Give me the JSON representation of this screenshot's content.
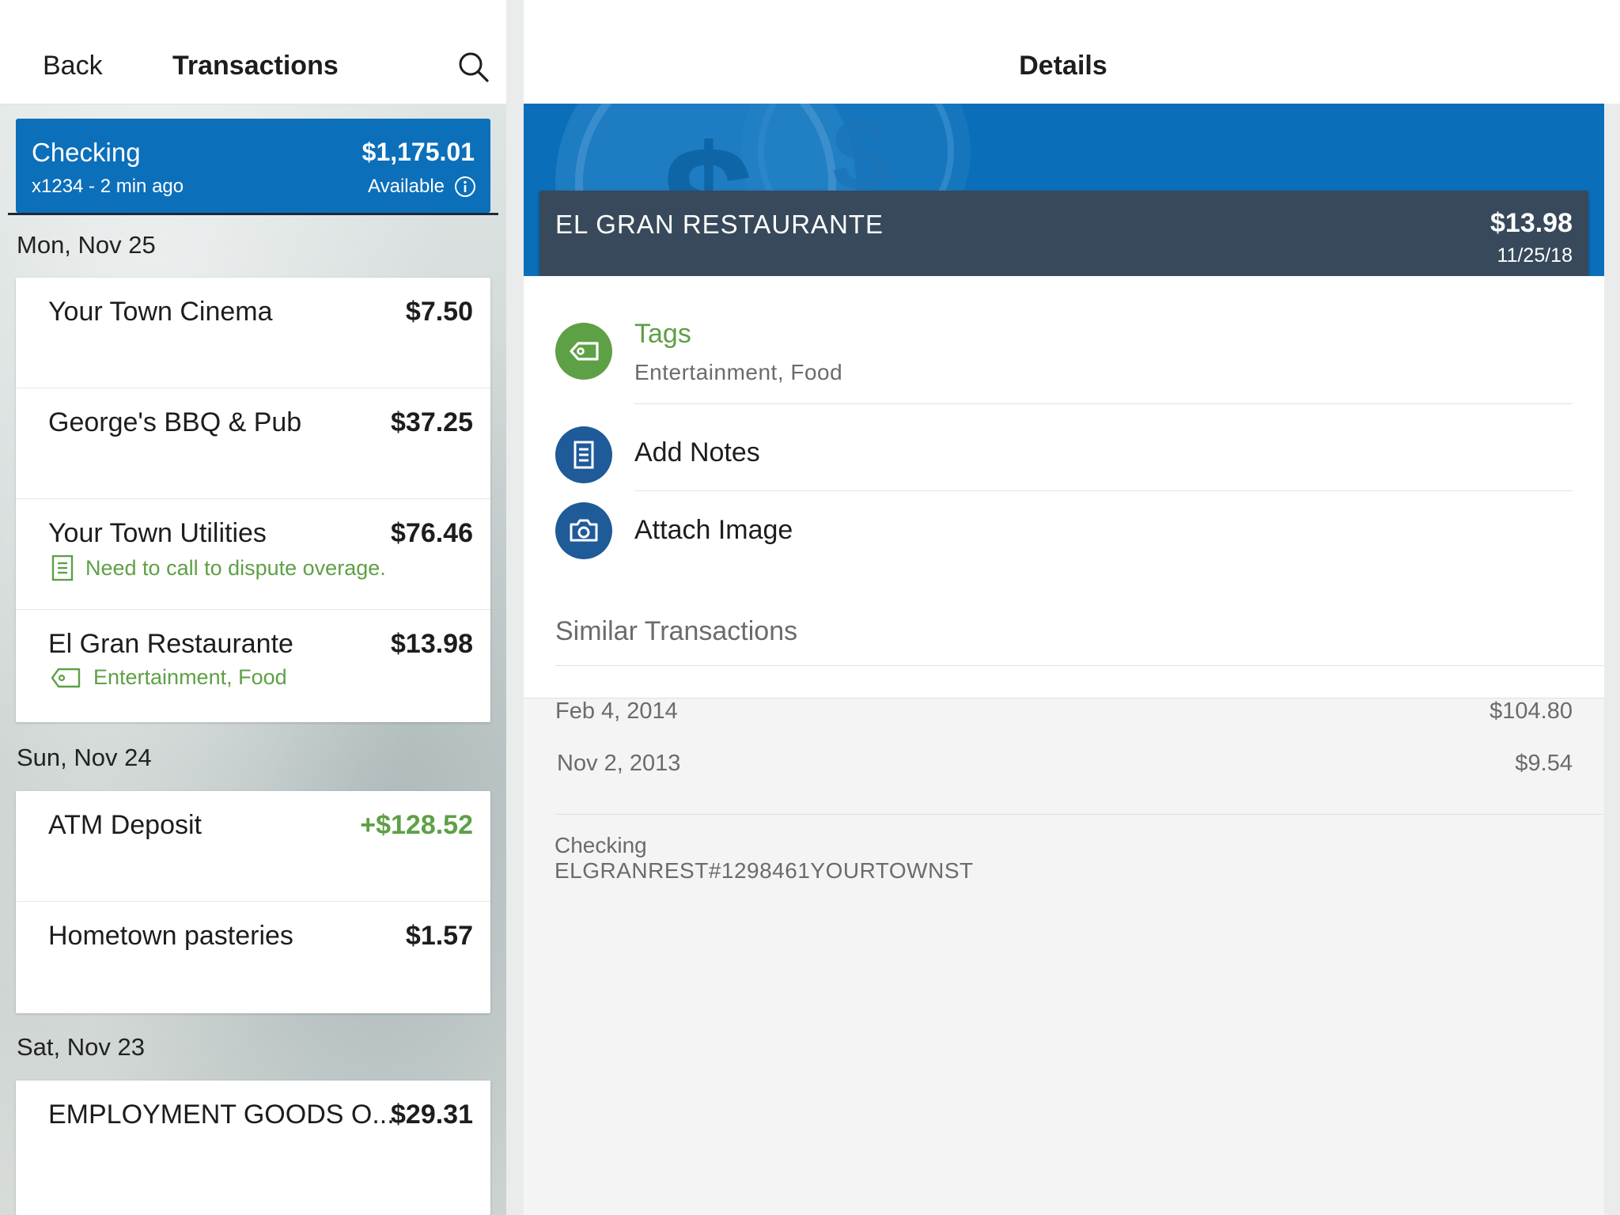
{
  "colors": {
    "brand_blue": "#0c6fba",
    "navy": "#37495a",
    "green": "#5ea046",
    "icon_blue": "#1f5a99",
    "muted_text": "#6b6b6b"
  },
  "left_header": {
    "back_label": "Back",
    "title": "Transactions",
    "search_icon": "search-icon"
  },
  "account": {
    "name": "Checking",
    "balance": "$1,175.01",
    "sub": "x1234 - 2 min ago",
    "available_label": "Available",
    "info_icon": "info-icon"
  },
  "groups": [
    {
      "date": "Mon, Nov 25",
      "transactions": [
        {
          "name": "Your Town Cinema",
          "amount": "$7.50"
        },
        {
          "name": "George's BBQ & Pub",
          "amount": "$37.25"
        },
        {
          "name": "Your Town Utilities",
          "amount": "$76.46",
          "note": "Need to call to dispute overage."
        },
        {
          "name": "El Gran Restaurante",
          "amount": "$13.98",
          "tags": "Entertainment, Food"
        }
      ]
    },
    {
      "date": "Sun, Nov 24",
      "transactions": [
        {
          "name": "ATM Deposit",
          "amount": "+$128.52"
        },
        {
          "name": "Hometown pasteries",
          "amount": "$1.57"
        }
      ]
    },
    {
      "date": "Sat, Nov 23",
      "transactions": [
        {
          "name": "EMPLOYMENT GOODS O...",
          "amount": "$29.31"
        }
      ]
    }
  ],
  "details": {
    "title": "Details",
    "merchant": "EL GRAN RESTAURANTE",
    "amount": "$13.98",
    "date": "11/25/18",
    "tags_label": "Tags",
    "tags_value": "Entertainment, Food",
    "add_notes_label": "Add Notes",
    "attach_image_label": "Attach Image",
    "similar_title": "Similar Transactions",
    "similar": [
      {
        "date": "Feb 4, 2014",
        "amount": "$104.80"
      },
      {
        "date": "Nov 2, 2013",
        "amount": "$9.54"
      }
    ],
    "account_type": "Checking",
    "account_desc": "ELGRANREST#1298461YOURTOWNST"
  }
}
